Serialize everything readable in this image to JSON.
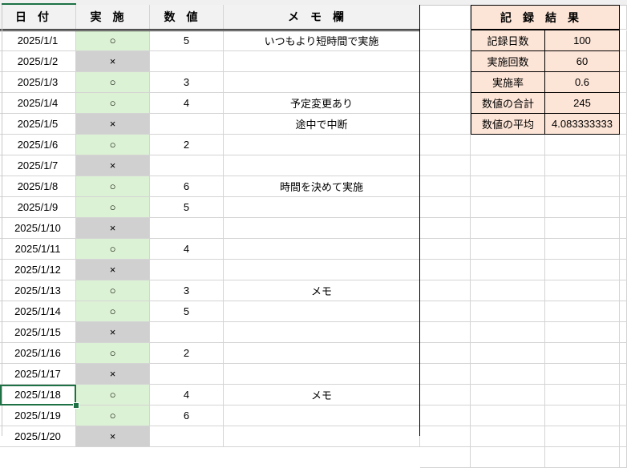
{
  "headers": {
    "date": "日付",
    "done": "実施",
    "value": "数値",
    "memo": "メモ欄"
  },
  "rows": [
    {
      "date": "2025/1/1",
      "done": "○",
      "value": "5",
      "memo": "いつもより短時間で実施"
    },
    {
      "date": "2025/1/2",
      "done": "×",
      "value": "",
      "memo": ""
    },
    {
      "date": "2025/1/3",
      "done": "○",
      "value": "3",
      "memo": ""
    },
    {
      "date": "2025/1/4",
      "done": "○",
      "value": "4",
      "memo": "予定変更あり"
    },
    {
      "date": "2025/1/5",
      "done": "×",
      "value": "",
      "memo": "途中で中断"
    },
    {
      "date": "2025/1/6",
      "done": "○",
      "value": "2",
      "memo": ""
    },
    {
      "date": "2025/1/7",
      "done": "×",
      "value": "",
      "memo": ""
    },
    {
      "date": "2025/1/8",
      "done": "○",
      "value": "6",
      "memo": "時間を決めて実施"
    },
    {
      "date": "2025/1/9",
      "done": "○",
      "value": "5",
      "memo": ""
    },
    {
      "date": "2025/1/10",
      "done": "×",
      "value": "",
      "memo": ""
    },
    {
      "date": "2025/1/11",
      "done": "○",
      "value": "4",
      "memo": ""
    },
    {
      "date": "2025/1/12",
      "done": "×",
      "value": "",
      "memo": ""
    },
    {
      "date": "2025/1/13",
      "done": "○",
      "value": "3",
      "memo": "メモ"
    },
    {
      "date": "2025/1/14",
      "done": "○",
      "value": "5",
      "memo": ""
    },
    {
      "date": "2025/1/15",
      "done": "×",
      "value": "",
      "memo": ""
    },
    {
      "date": "2025/1/16",
      "done": "○",
      "value": "2",
      "memo": ""
    },
    {
      "date": "2025/1/17",
      "done": "×",
      "value": "",
      "memo": ""
    },
    {
      "date": "2025/1/18",
      "done": "○",
      "value": "4",
      "memo": "メモ"
    },
    {
      "date": "2025/1/19",
      "done": "○",
      "value": "6",
      "memo": ""
    },
    {
      "date": "2025/1/20",
      "done": "×",
      "value": "",
      "memo": ""
    }
  ],
  "summary": {
    "title": "記録結果",
    "items": [
      {
        "label": "記録日数",
        "value": "100"
      },
      {
        "label": "実施回数",
        "value": "60"
      },
      {
        "label": "実施率",
        "value": "0.6"
      },
      {
        "label": "数値の合計",
        "value": "245"
      },
      {
        "label": "数値の平均",
        "value": "4.083333333"
      }
    ]
  },
  "colors": {
    "done": "#dcf2d4",
    "skip": "#d0d0d0",
    "summary": "#fce4d6",
    "selection": "#1e7145"
  }
}
